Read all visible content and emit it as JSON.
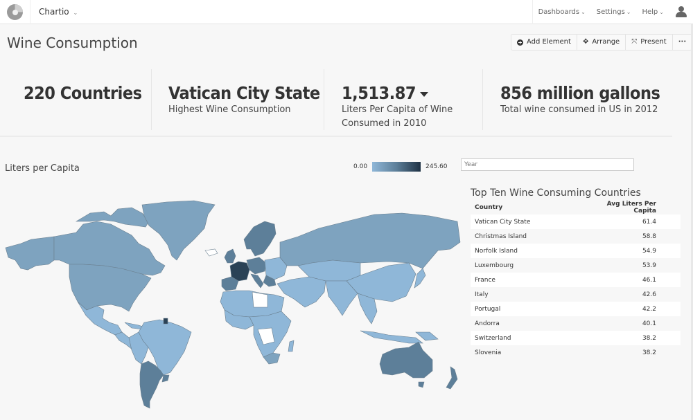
{
  "nav": {
    "org_name": "Chartio",
    "items": [
      {
        "label": "Dashboards"
      },
      {
        "label": "Settings"
      },
      {
        "label": "Help"
      }
    ],
    "chevron": "⌄"
  },
  "page": {
    "title": "Wine Consumption"
  },
  "toolbar": {
    "add_element": "Add Element",
    "arrange": "Arrange",
    "present": "Present",
    "more": "···"
  },
  "kpis": [
    {
      "value": "220 Countries",
      "label": ""
    },
    {
      "value": "Vatican City State",
      "label": "Highest Wine Consumption"
    },
    {
      "value": "1,513.87",
      "label": "Liters Per Capita of Wine Consumed in 2010",
      "trend": "down"
    },
    {
      "value": "856 million gallons",
      "label": "Total wine consumed in US in 2012"
    }
  ],
  "map": {
    "title": "Liters per Capita",
    "legend_min": "0.00",
    "legend_max": "245.60",
    "colors": {
      "low": "#8fb7d8",
      "mid": "#7ea3bf",
      "high": "#5d7f99",
      "top": "#2a4256",
      "nodata": "#ffffff"
    }
  },
  "filter": {
    "year_placeholder": "Year"
  },
  "table": {
    "title": "Top Ten Wine Consuming Countries",
    "columns": [
      "Country",
      "Avg Liters Per Capita"
    ],
    "rows": [
      {
        "country": "Vatican City State",
        "value": "61.4"
      },
      {
        "country": "Christmas Island",
        "value": "58.8"
      },
      {
        "country": "Norfolk Island",
        "value": "54.9"
      },
      {
        "country": "Luxembourg",
        "value": "53.9"
      },
      {
        "country": "France",
        "value": "46.1"
      },
      {
        "country": "Italy",
        "value": "42.6"
      },
      {
        "country": "Portugal",
        "value": "42.2"
      },
      {
        "country": "Andorra",
        "value": "40.1"
      },
      {
        "country": "Switzerland",
        "value": "38.2"
      },
      {
        "country": "Slovenia",
        "value": "38.2"
      }
    ]
  }
}
